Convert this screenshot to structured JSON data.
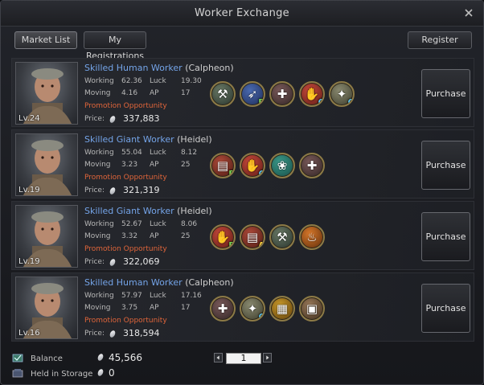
{
  "window": {
    "title": "Worker Exchange"
  },
  "tabs": [
    {
      "label": "Market List",
      "active": true
    },
    {
      "label": "My Registrations",
      "active": false
    }
  ],
  "register_label": "Register",
  "stat_labels": {
    "working": "Working",
    "moving": "Moving",
    "luck": "Luck",
    "ap": "AP"
  },
  "promotion_label": "Promotion Opportunity",
  "price_label": "Price:",
  "purchase_label": "Purchase",
  "workers": [
    {
      "name": "Skilled Human Worker",
      "town": "(Calpheon)",
      "level": "Lv.24",
      "working": "62.36",
      "luck": "19.30",
      "moving": "4.16",
      "ap": "17",
      "price": "337,883",
      "skills": [
        {
          "icon": "hammer-icon",
          "grade": ""
        },
        {
          "icon": "sprint-boot-icon",
          "grade": "B"
        },
        {
          "icon": "worker-vest-icon",
          "grade": ""
        },
        {
          "icon": "hand-glove-icon",
          "grade": "C"
        },
        {
          "icon": "sparkle-potion-icon",
          "grade": "C"
        }
      ]
    },
    {
      "name": "Skilled Giant Worker",
      "town": "(Heidel)",
      "level": "Lv.19",
      "working": "55.04",
      "luck": "8.12",
      "moving": "3.23",
      "ap": "25",
      "price": "321,319",
      "skills": [
        {
          "icon": "plank-bundle-icon",
          "grade": "B"
        },
        {
          "icon": "hand-glove-icon",
          "grade": "C"
        },
        {
          "icon": "herb-bundle-icon",
          "grade": ""
        },
        {
          "icon": "worker-vest-icon",
          "grade": ""
        }
      ]
    },
    {
      "name": "Skilled Giant Worker",
      "town": "(Heidel)",
      "level": "Lv.19",
      "working": "52.67",
      "luck": "8.06",
      "moving": "3.32",
      "ap": "25",
      "price": "322,069",
      "skills": [
        {
          "icon": "hand-glove-icon",
          "grade": "B"
        },
        {
          "icon": "plank-bundle-icon",
          "grade": "A"
        },
        {
          "icon": "hammer-icon",
          "grade": ""
        },
        {
          "icon": "furnace-fire-icon",
          "grade": ""
        }
      ]
    },
    {
      "name": "Skilled Human Worker",
      "town": "(Calpheon)",
      "level": "Lv.16",
      "working": "57.97",
      "luck": "17.16",
      "moving": "3.75",
      "ap": "17",
      "price": "318,594",
      "skills": [
        {
          "icon": "worker-vest-icon",
          "grade": ""
        },
        {
          "icon": "sparkle-potion-icon",
          "grade": "C"
        },
        {
          "icon": "gold-ingot-icon",
          "grade": ""
        },
        {
          "icon": "treasure-chest-icon",
          "grade": ""
        }
      ]
    }
  ],
  "footer": {
    "balance_label": "Balance",
    "balance_value": "45,566",
    "storage_label": "Held in Storage",
    "storage_value": "0",
    "page": "1"
  },
  "colors": {
    "worker_name": "#74a4e8",
    "promotion": "#e0653a",
    "grade_A": "#ffd23c",
    "grade_B": "#7ed957",
    "grade_C": "#5ec8f0",
    "skill_ring": "#8c7a46"
  }
}
